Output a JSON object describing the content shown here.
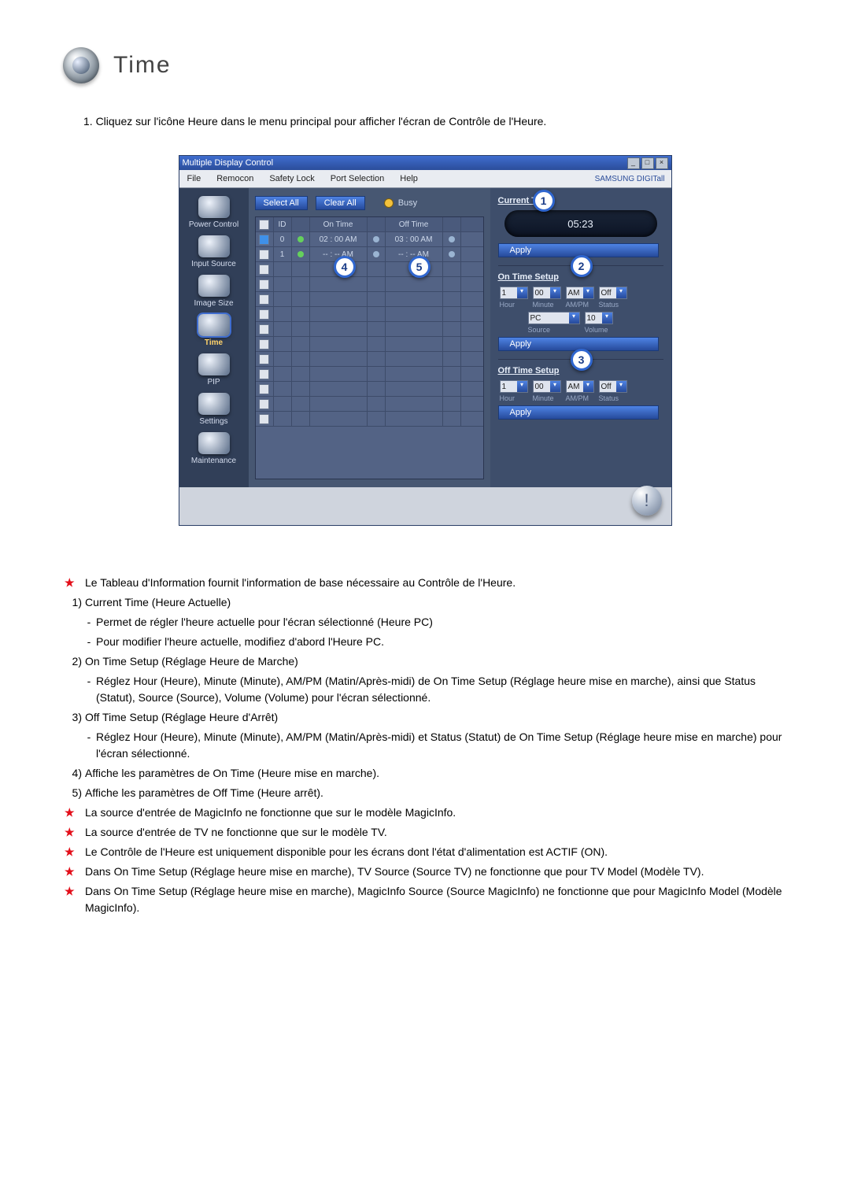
{
  "page": {
    "heading": "Time",
    "intro": "1. Cliquez sur l'icône Heure dans le menu principal pour afficher l'écran de Contrôle de l'Heure."
  },
  "app": {
    "title": "Multiple Display Control",
    "brand": "SAMSUNG DIGITall",
    "menu": {
      "file": "File",
      "remocon": "Remocon",
      "safety": "Safety Lock",
      "port": "Port Selection",
      "help": "Help"
    },
    "sidebar": {
      "power": "Power Control",
      "input": "Input Source",
      "image": "Image Size",
      "time": "Time",
      "pip": "PIP",
      "settings": "Settings",
      "maint": "Maintenance"
    },
    "toolbar": {
      "select_all": "Select All",
      "clear_all": "Clear All",
      "busy": "Busy"
    },
    "grid": {
      "head_on": "On Time",
      "head_off": "Off Time",
      "rows": [
        {
          "id": "0",
          "on": "02 : 00  AM",
          "off": "03 : 00  AM",
          "checked": true,
          "on_dot": true,
          "off_dot": true
        },
        {
          "id": "1",
          "on": "-- : --  AM",
          "off": "-- : --  AM",
          "checked": false,
          "on_dot": true,
          "off_dot": true
        }
      ]
    },
    "right": {
      "current_time_label": "Current Time",
      "current_time_value": "05:23",
      "apply": "Apply",
      "on_setup_label": "On Time Setup",
      "off_setup_label": "Off Time Setup",
      "hour": "1",
      "minute": "00",
      "ampm": "AM",
      "status": "Off",
      "source": "PC",
      "volume": "10",
      "lbl_hour": "Hour",
      "lbl_minute": "Minute",
      "lbl_ampm": "AM/PM",
      "lbl_status": "Status",
      "lbl_source": "Source",
      "lbl_volume": "Volume"
    },
    "badges": {
      "b1": "1",
      "b2": "2",
      "b3": "3",
      "b4": "4",
      "b5": "5"
    }
  },
  "notes": {
    "star1": "Le Tableau d'Information fournit l'information de base nécessaire au Contrôle de l'Heure.",
    "n1_head": "Current Time (Heure Actuelle)",
    "n1_a": "Permet de régler l'heure actuelle pour l'écran sélectionné (Heure PC)",
    "n1_b": "Pour modifier l'heure actuelle, modifiez d'abord l'Heure PC.",
    "n2_head": "On Time Setup (Réglage Heure de Marche)",
    "n2_a": "Réglez Hour (Heure), Minute (Minute), AM/PM (Matin/Après-midi) de On Time Setup (Réglage heure mise en marche), ainsi que Status (Statut), Source (Source), Volume (Volume) pour l'écran sélectionné.",
    "n3_head": "Off Time Setup (Réglage Heure d'Arrêt)",
    "n3_a": "Réglez Hour (Heure), Minute (Minute), AM/PM (Matin/Après-midi) et Status (Statut) de On Time Setup (Réglage heure mise en marche) pour l'écran sélectionné.",
    "n4": "Affiche les paramètres de On Time (Heure mise en marche).",
    "n5": "Affiche les paramètres de Off Time (Heure arrêt).",
    "star2": "La source d'entrée de MagicInfo ne fonctionne que sur le modèle MagicInfo.",
    "star3": "La source d'entrée de TV ne fonctionne que sur le modèle TV.",
    "star4": "Le Contrôle de l'Heure est uniquement disponible pour les écrans dont l'état d'alimentation est ACTIF (ON).",
    "star5": "Dans On Time Setup (Réglage heure mise en marche), TV Source (Source TV) ne fonctionne que pour TV Model (Modèle TV).",
    "star6": "Dans On Time Setup (Réglage heure mise en marche), MagicInfo Source (Source MagicInfo) ne fonctionne que pour MagicInfo Model (Modèle MagicInfo)."
  },
  "labels": {
    "num1": "1)",
    "num2": "2)",
    "num3": "3)",
    "num4": "4)",
    "num5": "5)",
    "dash": "-"
  }
}
